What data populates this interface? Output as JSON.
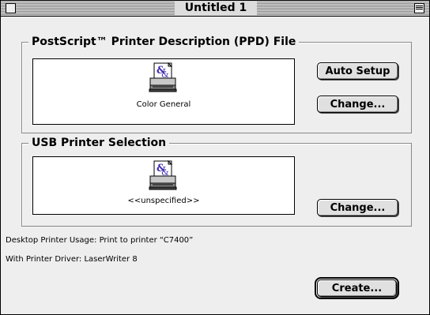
{
  "window": {
    "title": "Untitled 1"
  },
  "ppd_section": {
    "legend": "PostScript™ Printer Description (PPD) File",
    "printer_name": "Color General",
    "auto_setup_label": "Auto Setup",
    "change_label": "Change..."
  },
  "usb_section": {
    "legend": "USB Printer Selection",
    "printer_name": "<<unspecified>>",
    "change_label": "Change..."
  },
  "info": {
    "desktop_usage": "Desktop Printer Usage: Print to printer “C7400”",
    "printer_driver": "With Printer Driver: LaserWriter 8"
  },
  "create_label": "Create..."
}
